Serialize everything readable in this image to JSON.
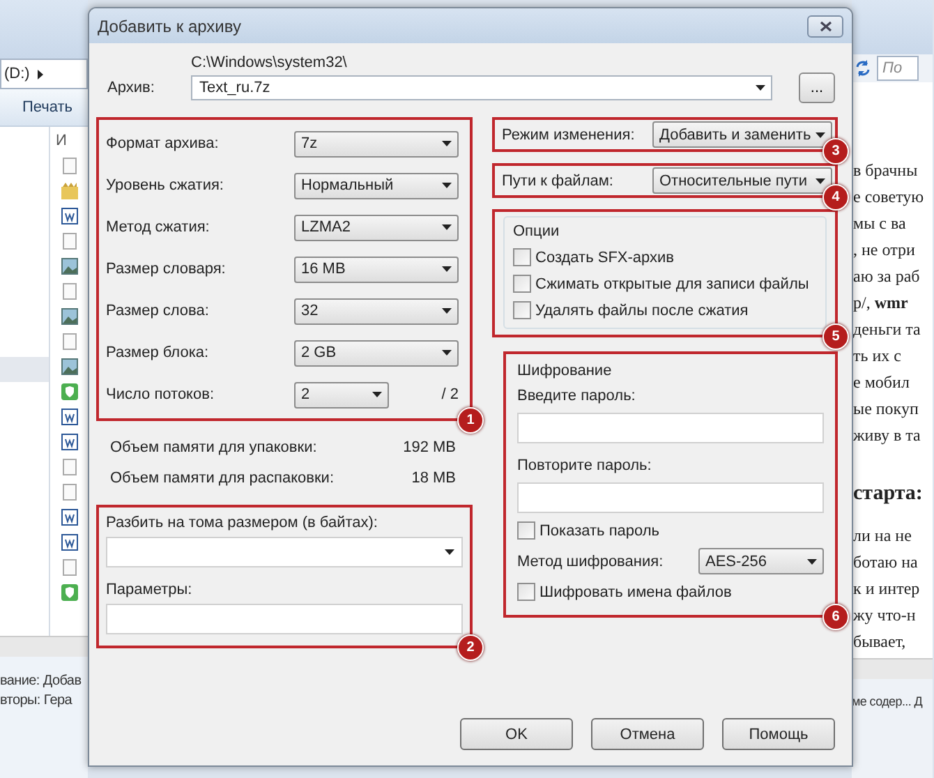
{
  "explorer": {
    "address": "(D:)",
    "toolbar_button": "Печать",
    "column_header": "И",
    "file_icons": [
      {
        "kind": "blank"
      },
      {
        "kind": "program"
      },
      {
        "kind": "document"
      },
      {
        "kind": "blank"
      },
      {
        "kind": "image"
      },
      {
        "kind": "blank"
      },
      {
        "kind": "image"
      },
      {
        "kind": "blank"
      },
      {
        "kind": "image"
      },
      {
        "kind": "shield"
      },
      {
        "kind": "document"
      },
      {
        "kind": "document"
      },
      {
        "kind": "blank"
      },
      {
        "kind": "blank"
      },
      {
        "kind": "document"
      },
      {
        "kind": "document"
      },
      {
        "kind": "blank"
      },
      {
        "kind": "shield"
      }
    ],
    "status_lines": [
      "вание: Добав",
      "вторы: Гера"
    ]
  },
  "dialog": {
    "title": "Добавить к архиву",
    "archive": {
      "label": "Архив:",
      "path": "C:\\Windows\\system32\\",
      "value": "Text_ru.7z",
      "browse": "..."
    },
    "settings": {
      "badge": "1",
      "rows": [
        {
          "kind": "select",
          "label": "Формат архива:",
          "value": "7z"
        },
        {
          "kind": "select",
          "label": "Уровень сжатия:",
          "value": "Нормальный"
        },
        {
          "kind": "select",
          "label": "Метод сжатия:",
          "value": "LZMA2"
        },
        {
          "kind": "select",
          "label": "Размер словаря:",
          "value": "16 MB"
        },
        {
          "kind": "select",
          "label": "Размер слова:",
          "value": "32"
        },
        {
          "kind": "select",
          "label": "Размер блока:",
          "value": "2 GB"
        },
        {
          "kind": "threads",
          "label": "Число потоков:",
          "value": "2",
          "suffix": "/ 2"
        }
      ]
    },
    "memory": [
      {
        "label": "Объем памяти для упаковки:",
        "value": "192 MB"
      },
      {
        "label": "Объем памяти для распаковки:",
        "value": "18 MB"
      }
    ],
    "split": {
      "badge": "2",
      "label": "Разбить на тома размером (в байтах):",
      "params_label": "Параметры:"
    },
    "update_mode": {
      "badge": "3",
      "label": "Режим изменения:",
      "value": "Добавить и заменить"
    },
    "path_mode": {
      "badge": "4",
      "label": "Пути к файлам:",
      "value": "Относительные пути"
    },
    "options": {
      "badge": "5",
      "title": "Опции",
      "items": [
        {
          "label": "Создать SFX-архив",
          "checked": false
        },
        {
          "label": "Сжимать открытые для записи файлы",
          "checked": false
        },
        {
          "label": "Удалять файлы после сжатия",
          "checked": false
        }
      ]
    },
    "encryption": {
      "badge": "6",
      "title": "Шифрование",
      "password_label": "Введите пароль:",
      "repeat_label": "Повторите пароль:",
      "show_password": {
        "label": "Показать пароль",
        "checked": false
      },
      "method_label": "Метод шифрования:",
      "method": "AES-256",
      "encrypt_names": {
        "label": "Шифровать имена файлов",
        "checked": false
      }
    },
    "buttons": [
      "OK",
      "Отмена",
      "Помощь"
    ]
  },
  "document": {
    "search_placeholder": "По",
    "lines": [
      {
        "kind": "para",
        "text": "в брачны"
      },
      {
        "kind": "para",
        "text": "е советую"
      },
      {
        "kind": "para",
        "text": "мы с ва"
      },
      {
        "kind": "para",
        "text": ", не отри"
      },
      {
        "kind": "para",
        "text": "аю за раб"
      },
      {
        "kind": "para",
        "text": "р/, **wmr**"
      },
      {
        "kind": "para",
        "text": "деньги та"
      },
      {
        "kind": "para",
        "text": "ть их с"
      },
      {
        "kind": "para",
        "text": "е мобил"
      },
      {
        "kind": "para",
        "text": "ые покуп"
      },
      {
        "kind": "para",
        "text": "живу в та"
      },
      {
        "kind": "heading",
        "text": "старта:"
      },
      {
        "kind": "para",
        "text": "ли на не"
      },
      {
        "kind": "para",
        "text": "ботаю на"
      },
      {
        "kind": "para",
        "text": "к и интер"
      },
      {
        "kind": "para",
        "text": "жу что-н"
      },
      {
        "kind": "para",
        "text": "бывает,"
      }
    ],
    "status": "ме содер... Д"
  }
}
